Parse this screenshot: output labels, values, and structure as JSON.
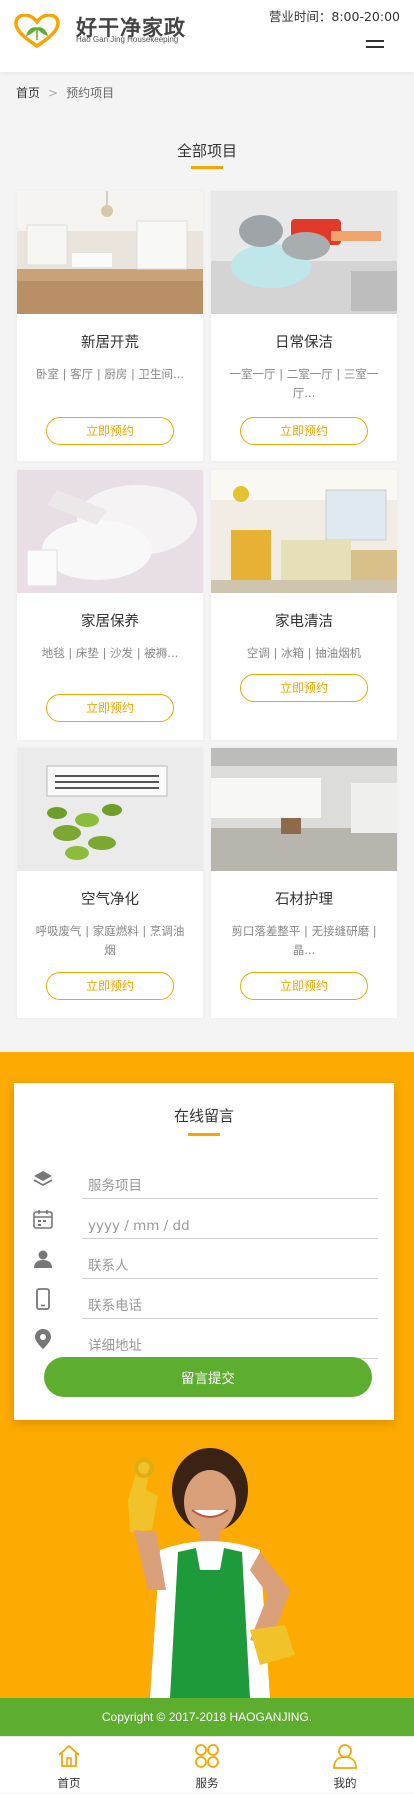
{
  "header": {
    "brand_cn": "好干净家政",
    "brand_en": "Hao Gan Jing Housekeeping",
    "business_hours": "营业时间：8:00-20:00",
    "menu_icon": "hamburger-menu-icon"
  },
  "breadcrumb": {
    "home": "首页",
    "separator": ">",
    "current": "预约项目"
  },
  "section": {
    "title": "全部项目"
  },
  "services": [
    {
      "title": "新居开荒",
      "desc": "卧室 | 客厅 | 厨房 | 卫生间...",
      "button": "立即预约",
      "image": "bright-living-room-photo"
    },
    {
      "title": "日常保洁",
      "desc": "一室一厅 | 二室一厅 | 三室一厅...",
      "button": "立即预约",
      "image": "gloved-hands-cleaning-sink-photo"
    },
    {
      "title": "家居保养",
      "desc": "地毯 | 床垫 | 沙发 | 被褥...",
      "button": "立即预约",
      "image": "white-gloves-photo"
    },
    {
      "title": "家电清洁",
      "desc": "空调 | 冰箱 | 抽油烟机",
      "button": "立即预约",
      "image": "kitchen-interior-photo"
    },
    {
      "title": "空气净化",
      "desc": "呼吸废气 | 家庭燃料 | 烹调油烟",
      "button": "立即预约",
      "image": "air-conditioner-with-plant-photo"
    },
    {
      "title": "石材护理",
      "desc": "剪口落差整平 | 无接缝研磨 | 晶...",
      "button": "立即预约",
      "image": "empty-stone-floor-room-photo"
    }
  ],
  "message_form": {
    "title": "在线留言",
    "fields": [
      {
        "icon": "layers-icon",
        "placeholder": "服务项目",
        "type": "text"
      },
      {
        "icon": "calendar-icon",
        "placeholder": "yyyy / mm / dd",
        "type": "text"
      },
      {
        "icon": "person-icon",
        "placeholder": "联系人",
        "type": "text"
      },
      {
        "icon": "phone-icon",
        "placeholder": "联系电话",
        "type": "text"
      },
      {
        "icon": "location-pin-icon",
        "placeholder": "详细地址",
        "type": "text"
      }
    ],
    "submit": "留言提交"
  },
  "footer": {
    "copyright": "Copyright © 2017-2018 HAOGANJING."
  },
  "bottom_nav": [
    {
      "label": "首页",
      "icon": "home-icon"
    },
    {
      "label": "服务",
      "icon": "grid-circles-icon"
    },
    {
      "label": "我的",
      "icon": "user-icon"
    }
  ],
  "colors": {
    "accent_orange": "#f7a500",
    "yellow_bg": "#fdaa02",
    "green": "#5dad2f",
    "page_bg": "#f4f4f4"
  }
}
